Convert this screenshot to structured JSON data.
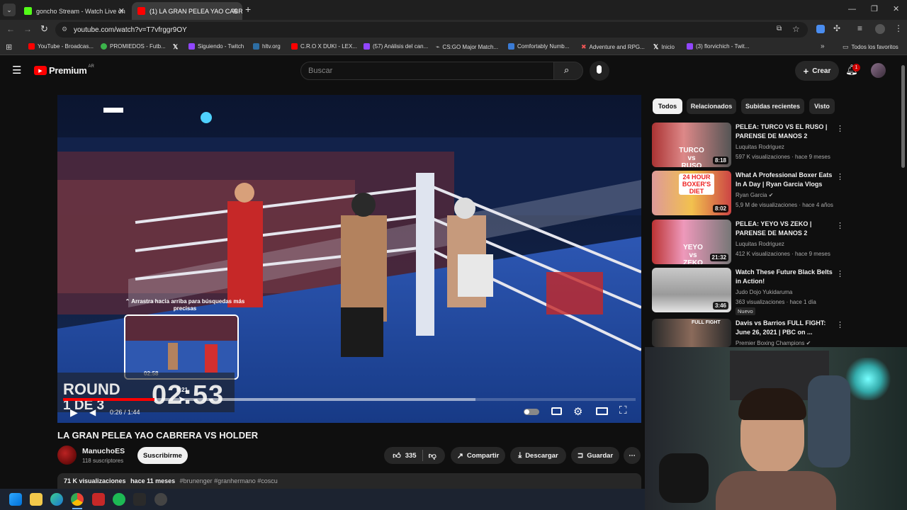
{
  "browser": {
    "tabs": [
      {
        "label": "goncho Stream - Watch Live on",
        "active": false
      },
      {
        "label": "(1) LA GRAN PELEA YAO CABRE",
        "active": true
      }
    ],
    "new_tab": "+",
    "url": "youtube.com/watch?v=T7vfrggr9OY",
    "bookmarks": [
      "YouTube - Broadcas...",
      "PROMIEDOS - Futb...",
      "",
      "Siguiendo - Twitch",
      "hltv.org",
      "C.R.O X DUKI - LEX...",
      "(57) Análisis del can...",
      "CS:GO Major Match...",
      "Comfortably Numb...",
      "Adventure and RPG...",
      "Inicio",
      "(3) florvichich - Twit..."
    ],
    "all_favorites": "Todos los favoritos"
  },
  "youtube": {
    "logo": "Premium",
    "region": "AR",
    "search_placeholder": "Buscar",
    "create_label": "Crear",
    "notif_count": "1"
  },
  "player": {
    "drag_hint": "Arrastra hacia arriba para búsquedas más precisas",
    "preview_time": "02:58",
    "hover_time": "0:21",
    "overlay_round": "ROUND",
    "overlay_round_of": "1 DE 3",
    "overlay_clock": "02:53",
    "time_current": "0:26",
    "time_total": "1:44",
    "progress": 0.16,
    "buffered": 0.72
  },
  "video": {
    "title": "LA GRAN PELEA YAO CABRERA VS HOLDER",
    "channel": "ManuchoES",
    "subscribers": "118 suscriptores",
    "subscribe_label": "Suscribirme",
    "likes": "335",
    "share_label": "Compartir",
    "download_label": "Descargar",
    "save_label": "Guardar",
    "views": "71 K visualizaciones",
    "age": "hace 11 meses",
    "hashtags": "#brunenger #granhermano #coscu"
  },
  "chips": [
    "Todos",
    "Relacionados",
    "Subidas recientes",
    "Visto"
  ],
  "recommended": [
    {
      "title": "PELEA: TURCO VS EL RUSO | PARENSE DE MANOS 2",
      "channel": "Luquitas Rodriguez",
      "meta": "597 K visualizaciones · hace 9 meses",
      "duration": "8:18",
      "thumb_text": "TURCO vs RUSO",
      "verified": false,
      "badge": ""
    },
    {
      "title": "What A Professional Boxer Eats In A Day | Ryan Garcia Vlogs",
      "channel": "Ryan Garcia",
      "meta": "5,9 M de visualizaciones · hace 4 años",
      "duration": "8:02",
      "thumb_text": "24 HOUR BOXER'S DIET",
      "verified": true,
      "badge": ""
    },
    {
      "title": "PELEA: YEYO VS ZEKO | PARENSE DE MANOS 2",
      "channel": "Luquitas Rodriguez",
      "meta": "412 K visualizaciones · hace 9 meses",
      "duration": "21:32",
      "thumb_text": "YEYO vs ZEKO",
      "verified": false,
      "badge": ""
    },
    {
      "title": "Watch These Future Black Belts in Action!",
      "channel": "Judo Dojo Yukidaruma",
      "meta": "363 visualizaciones · hace 1 día",
      "duration": "3:46",
      "thumb_text": "",
      "verified": false,
      "badge": "Nuevo"
    },
    {
      "title": "Davis vs Barrios FULL FIGHT: June 26, 2021 | PBC on ...",
      "channel": "Premier Boxing Champions",
      "meta": "",
      "duration": "",
      "thumb_text": "FULL FIGHT",
      "verified": true,
      "badge": ""
    }
  ],
  "colors": {
    "accent_red": "#ff0000",
    "background": "#0f0f0f",
    "chip_active_bg": "#f1f1f1",
    "chip_bg": "#272727"
  }
}
